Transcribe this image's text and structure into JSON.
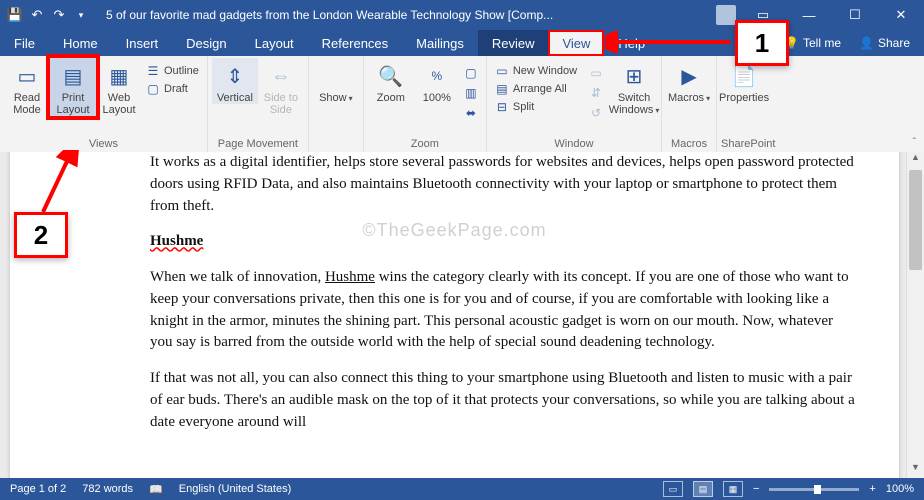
{
  "titlebar": {
    "title": "5 of our favorite mad gadgets from the London Wearable Technology Show [Comp..."
  },
  "menu": {
    "file": "File",
    "home": "Home",
    "insert": "Insert",
    "design": "Design",
    "layout": "Layout",
    "references": "References",
    "mailings": "Mailings",
    "review": "Review",
    "view": "View",
    "help": "Help",
    "tellme": "Tell me",
    "share": "Share"
  },
  "ribbon": {
    "views": {
      "read": "Read Mode",
      "print": "Print Layout",
      "web": "Web Layout",
      "outline": "Outline",
      "draft": "Draft",
      "cap": "Views"
    },
    "movement": {
      "vertical": "Vertical",
      "side": "Side to Side",
      "cap": "Page Movement"
    },
    "show": {
      "show": "Show",
      "cap": ""
    },
    "zoom": {
      "zoom": "Zoom",
      "pct": "100%",
      "cap": "Zoom"
    },
    "window": {
      "new": "New Window",
      "arrange": "Arrange All",
      "split": "Split",
      "switch": "Switch Windows",
      "cap": "Window"
    },
    "macros": {
      "macros": "Macros",
      "cap": "Macros"
    },
    "sharepoint": {
      "props": "Properties",
      "cap": "SharePoint"
    }
  },
  "doc": {
    "p1": "It works as a digital identifier, helps store several passwords for websites and devices, helps open password protected doors using RFID Data, and also maintains Bluetooth connectivity with your laptop or smartphone to protect them from theft.",
    "h1": "Hushme",
    "p2_a": "When we talk of innovation, ",
    "p2_link": "Hushme",
    "p2_b": " wins the category clearly with its concept. If you are one of those who want to keep your conversations private, then this one is for you and of course, if you are comfortable with looking like a knight in the armor, minutes the shining part. This personal acoustic gadget is worn on our mouth. Now, whatever you say is barred from the outside world with the help of special sound deadening technology.",
    "p3": "If that was not all, you can also connect this thing to your smartphone using Bluetooth and listen to music with a pair of ear buds. There's an audible mask on the top of it that protects your conversations, so while you are talking about a date everyone around will"
  },
  "status": {
    "page": "Page 1 of 2",
    "words": "782 words",
    "lang": "English (United States)",
    "zoom": "100%"
  },
  "wm": "©TheGeekPage.com",
  "callouts": {
    "c1": "1",
    "c2": "2"
  }
}
